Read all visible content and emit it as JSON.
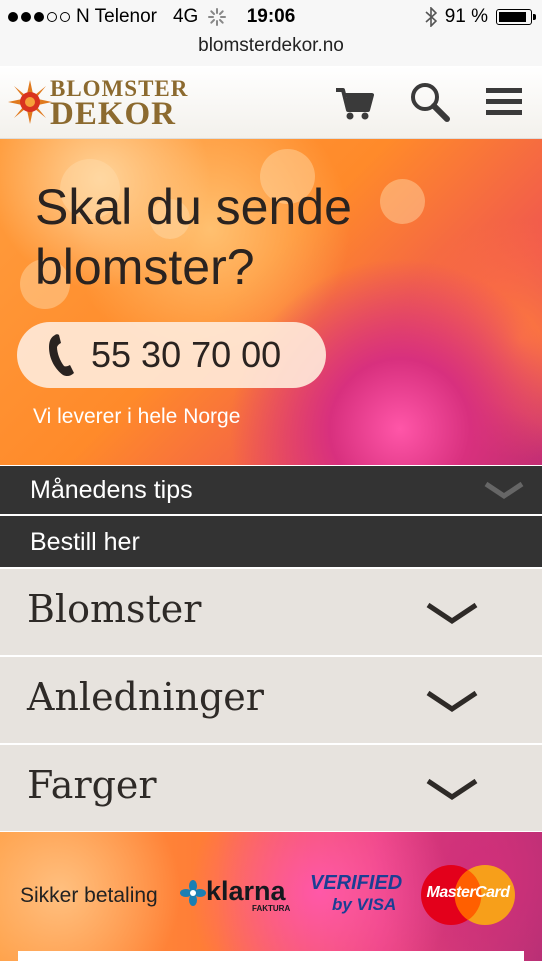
{
  "status_bar": {
    "carrier": "N Telenor",
    "network": "4G",
    "time": "19:06",
    "battery_text": "91 %",
    "battery_level": 0.91,
    "signal_bars_filled": 3,
    "signal_bars_total": 5
  },
  "browser": {
    "url": "blomsterdekor.no"
  },
  "header": {
    "logo_line1": "BLOMSTER",
    "logo_line2": "DEKOR",
    "icons": [
      "cart-icon",
      "search-icon",
      "menu-icon"
    ]
  },
  "hero": {
    "title_line1": "Skal du sende",
    "title_line2": "blomster?",
    "phone": "55 30 70 00",
    "subtitle": "Vi leverer i hele Norge"
  },
  "tips": {
    "label": "Månedens tips"
  },
  "order": {
    "label": "Bestill her"
  },
  "accordion": [
    {
      "label": "Blomster"
    },
    {
      "label": "Anledninger"
    },
    {
      "label": "Farger"
    }
  ],
  "footer": {
    "secure_label": "Sikker betaling",
    "klarna": "klarna",
    "klarna_sub": "FAKTURA",
    "visa_line1": "VERIFIED",
    "visa_line2": "by VISA",
    "mastercard": "MasterCard"
  },
  "colors": {
    "dark_bar": "#333333",
    "accordion_bg": "#e7e3de",
    "logo_gold": "#8c6a2f",
    "hero_orange": "#ff8a2a"
  }
}
